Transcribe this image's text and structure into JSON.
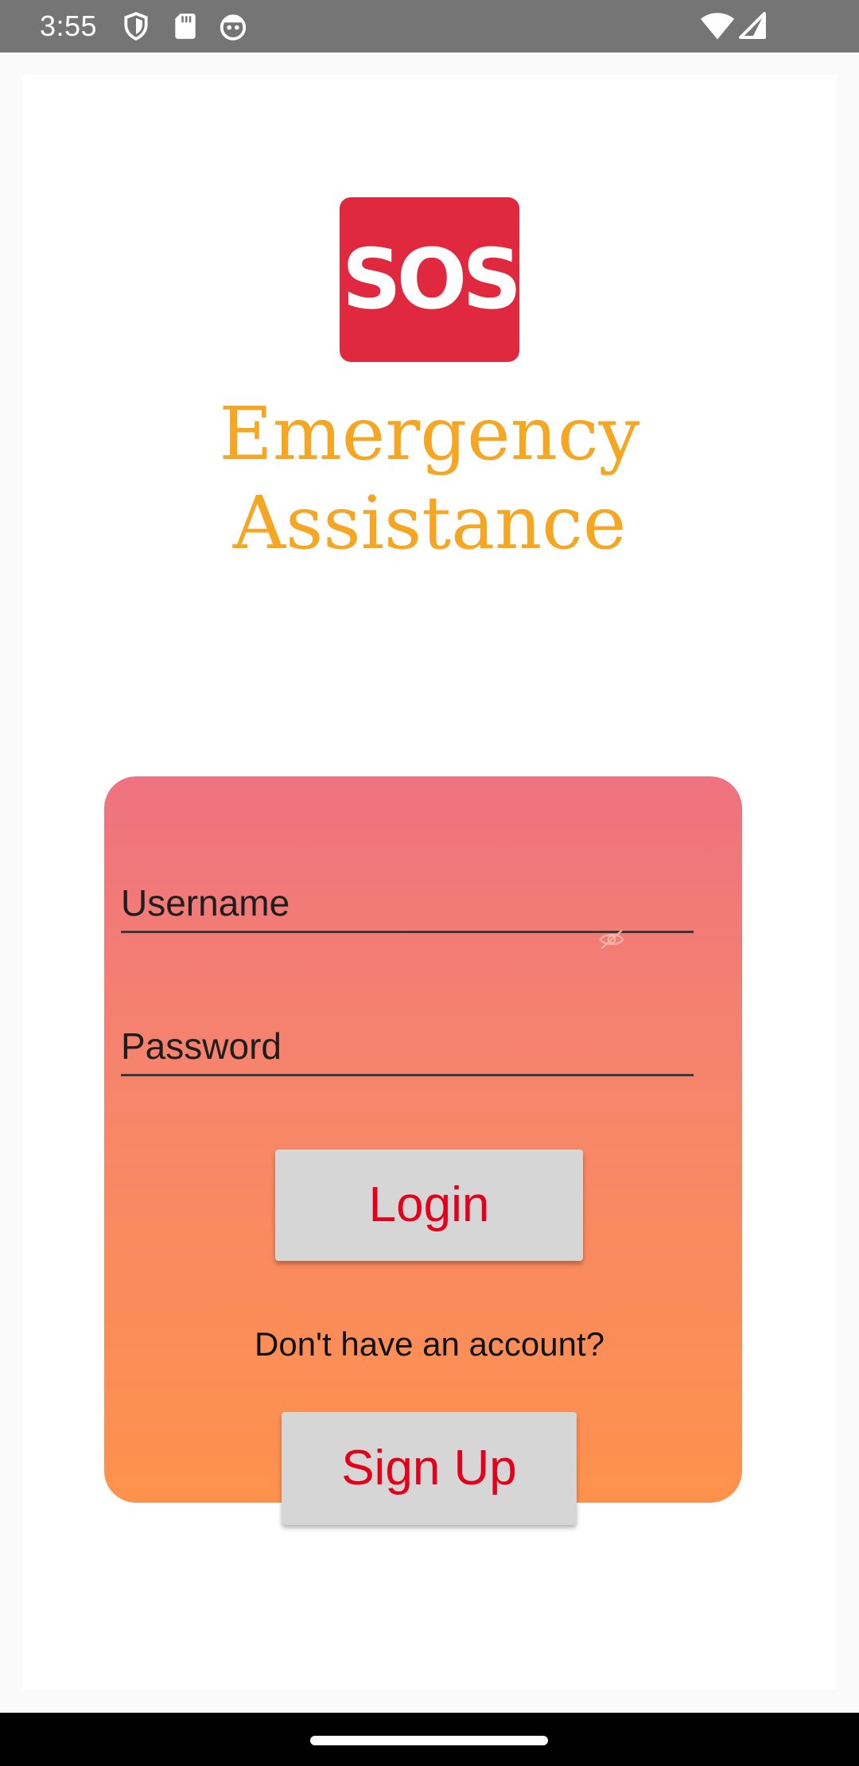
{
  "status_bar": {
    "time": "3:55",
    "left_icons": [
      "shield-icon",
      "sd-card-icon",
      "robot-face-icon"
    ],
    "right_icons": [
      "wifi-icon",
      "cell-signal-icon"
    ]
  },
  "logo": {
    "text": "SOS",
    "bg_color": "#e0293f"
  },
  "app": {
    "title_line1": "Emergency",
    "title_line2": "Assistance",
    "title_color": "#f5a623"
  },
  "form": {
    "username_placeholder": "Username",
    "username_value": "",
    "password_placeholder": "Password",
    "password_value": "",
    "login_label": "Login",
    "no_account_text": "Don't have an account?",
    "signup_label": "Sign Up",
    "button_text_color": "#e3001b",
    "card_gradient": [
      "#ee7280",
      "#fe924c"
    ]
  },
  "nav_bar": {
    "home_indicator": "home-pill"
  }
}
